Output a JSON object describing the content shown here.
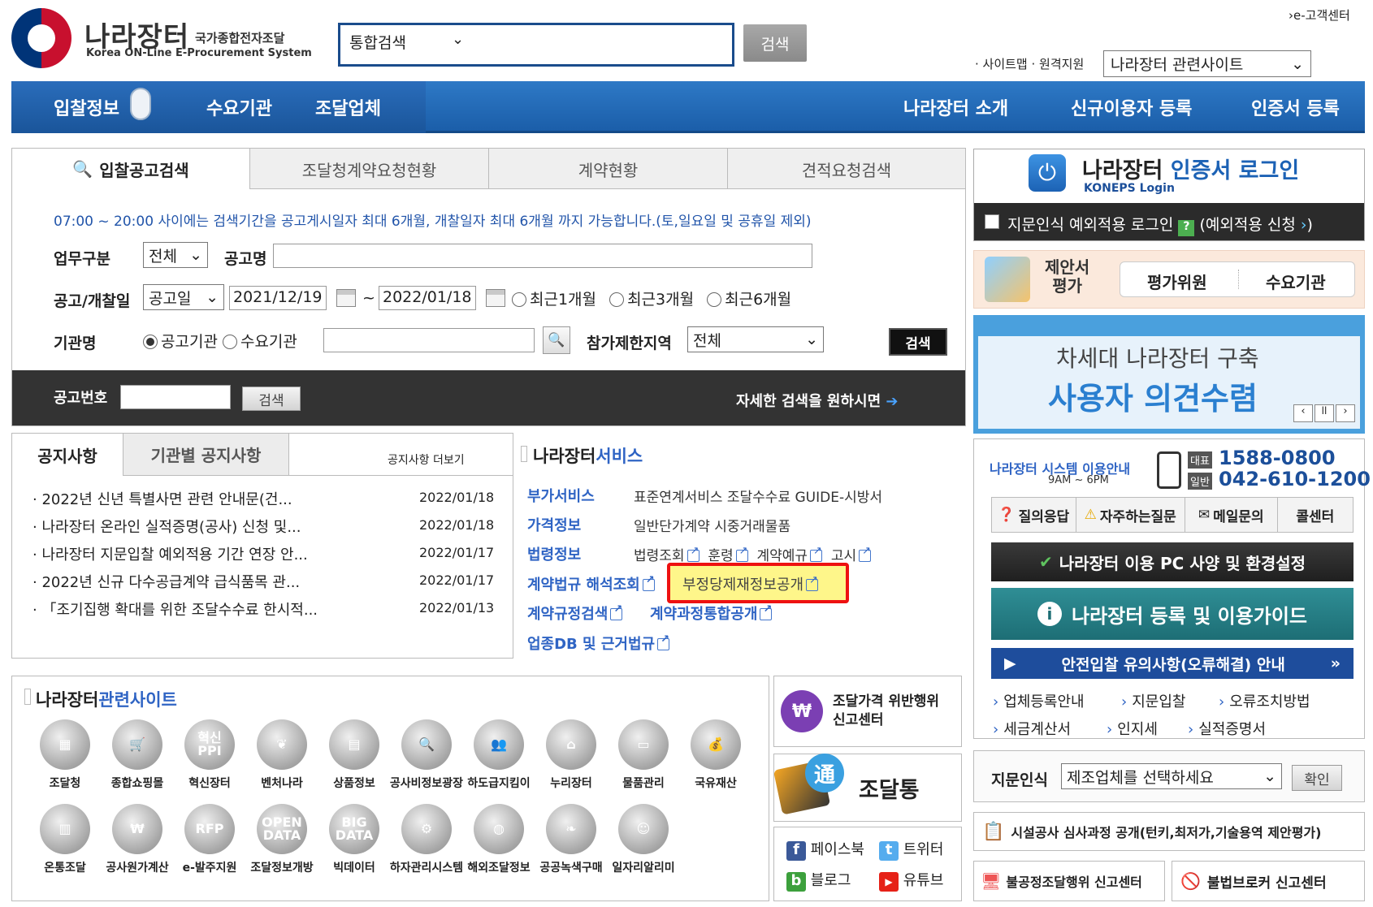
{
  "header": {
    "logo_title": "나라장터",
    "logo_sub": "국가종합전자조달",
    "logo_en": "Korea ON-Line E-Procurement System",
    "search_scope": "통합검색",
    "search_button": "검색",
    "customer_center": "›e-고객센터",
    "site_links": "· 사이트맵 · 원격지원",
    "related_site_select": "나라장터 관련사이트"
  },
  "nav": {
    "items": [
      "입찰정보",
      "수요기관",
      "조달업체",
      "나라장터 소개",
      "신규이용자 등록",
      "인증서 등록"
    ]
  },
  "search_panel": {
    "tabs": [
      "입찰공고검색",
      "조달청계약요청현황",
      "계약현황",
      "견적요청검색"
    ],
    "notice": "07:00 ~ 20:00 사이에는 검색기간을 공고게시일자 최대 6개월, 개찰일자 최대 6개월 까지 가능합니다.(토,일요일 및 공휴일 제외)",
    "business_label": "업무구분",
    "business_value": "전체",
    "title_label": "공고명",
    "date_label": "공고/개찰일",
    "date_type": "공고일",
    "date_from": "2021/12/19",
    "date_sep": "~",
    "date_to": "2022/01/18",
    "period_options": [
      "최근1개월",
      "최근3개월",
      "최근6개월"
    ],
    "agency_label": "기관명",
    "agency_options": [
      "공고기관",
      "수요기관"
    ],
    "region_label": "참가제한지역",
    "region_value": "전체",
    "search_button": "검색",
    "notice_no_label": "공고번호",
    "notice_no_button": "검색",
    "detail_search_link": "자세한 검색을 원하시면"
  },
  "notices": {
    "tabs": [
      "공지사항",
      "기관별 공지사항"
    ],
    "more": "공지사항 더보기",
    "items": [
      {
        "title": "· 2022년 신년 특별사면 관련 안내문(건...",
        "date": "2022/01/18"
      },
      {
        "title": "· 나라장터 온라인 실적증명(공사) 신청 및...",
        "date": "2022/01/18"
      },
      {
        "title": "· 나라장터 지문입찰 예외적용 기간 연장 안...",
        "date": "2022/01/17"
      },
      {
        "title": "· 2022년 신규 다수공급계약 급식품목 관...",
        "date": "2022/01/17"
      },
      {
        "title": "· 「조기집행 확대를 위한 조달수수료 한시적...",
        "date": "2022/01/13"
      }
    ]
  },
  "services": {
    "title_a": "나라장터",
    "title_b": "서비스",
    "rows": [
      {
        "cat": "부가서비스",
        "text": "표준연계서비스  조달수수료  GUIDE-시방서"
      },
      {
        "cat": "가격정보",
        "text": "일반단가계약  시중거래물품"
      },
      {
        "cat": "법령정보",
        "items": [
          "법령조회",
          "훈령",
          "계약예규",
          "고시"
        ]
      }
    ],
    "contract_law": "계약법규 해석조회",
    "fraud_info": "부정당제재정보공개",
    "contract_rules": "계약규정검색",
    "contract_process": "계약과정통합공개",
    "industry_db": "업종DB 및 근거법규"
  },
  "related_sites": {
    "title_a": "나라장터",
    "title_b": "관련사이트",
    "row1": [
      {
        "label": "조달청",
        "glyph": "▦"
      },
      {
        "label": "종합쇼핑몰",
        "glyph": "🛒"
      },
      {
        "label": "혁신장터",
        "glyph": "혁신\nPPI"
      },
      {
        "label": "벤처나라",
        "glyph": "❦"
      },
      {
        "label": "상품정보",
        "glyph": "▤"
      },
      {
        "label": "공사비정보광장",
        "glyph": "🔍"
      },
      {
        "label": "하도급지킴이",
        "glyph": "👥"
      },
      {
        "label": "누리장터",
        "glyph": "⌂"
      },
      {
        "label": "물품관리",
        "glyph": "▭"
      },
      {
        "label": "국유재산",
        "glyph": "💰"
      }
    ],
    "row2": [
      {
        "label": "온통조달",
        "glyph": "▥"
      },
      {
        "label": "공사원가계산",
        "glyph": "₩"
      },
      {
        "label": "e-발주지원",
        "glyph": "RFP"
      },
      {
        "label": "조달정보개방",
        "glyph": "OPEN DATA"
      },
      {
        "label": "빅데이터",
        "glyph": "BIG DATA"
      },
      {
        "label": "하자관리시스템",
        "glyph": "⚙"
      },
      {
        "label": "해외조달정보",
        "glyph": "◍"
      },
      {
        "label": "공공녹색구매",
        "glyph": "❧"
      },
      {
        "label": "일자리알리미",
        "glyph": "☺"
      }
    ]
  },
  "side_mid": {
    "violation_center": "조달가격 위반행위\n신고센터",
    "jodaltong": "조달통",
    "jodaltong_badge": "通",
    "social": [
      "페이스북",
      "트위터",
      "블로그",
      "유튜브"
    ]
  },
  "login": {
    "title_a": "나라장터 ",
    "title_b": "인증서 로그인",
    "title_en": "KONEPS Login",
    "fingerprint": "지문인식 예외적용 로그인",
    "exception_apply": "(예외적용 신청",
    "proposal": "제안서\n평가",
    "evaluator": "평가위원",
    "agency": "수요기관"
  },
  "banner": {
    "line1": "차세대 나라장터 구축",
    "line2": "사용자 의견수렴"
  },
  "contact": {
    "guide": "나라장터 시스템 이용안내",
    "hours": "9AM ~ 6PM",
    "rep_tag": "대표",
    "rep_phone": "1588-0800",
    "general_tag": "일반",
    "general_phone": "042-610-1200",
    "help_buttons": [
      "질의응답",
      "자주하는질문",
      "메일문의",
      "콜센터"
    ]
  },
  "guides": {
    "pc_spec": "나라장터 이용 PC 사양 및 환경설정",
    "register_guide": "나라장터 등록 및 이용가이드",
    "safe_bid": "안전입찰 유의사항(오류해결) 안내",
    "links_row1": [
      "업체등록안내",
      "지문입찰",
      "오류조치방법"
    ],
    "links_row2": [
      "세금계산서",
      "인지세",
      "실적증명서"
    ]
  },
  "fingerprint_sel": {
    "label": "지문인식",
    "value": "제조업체를 선택하세요",
    "confirm": "확인"
  },
  "bottom": {
    "facility": "시설공사 심사과정 공개(턴키,최저가,기술용역 제안평가)",
    "unfair": "불공정조달행위 신고센터",
    "broker": "불법브로커 신고센터"
  }
}
